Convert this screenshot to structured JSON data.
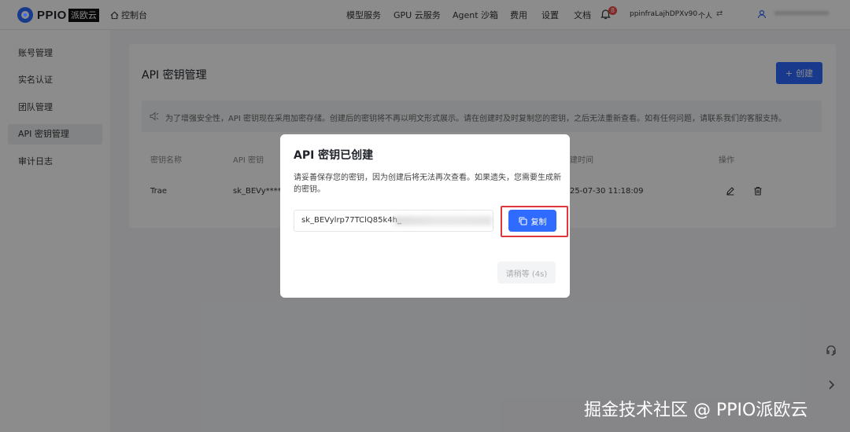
{
  "brand": {
    "name": "PPIO",
    "badge": "派欧云"
  },
  "topbar": {
    "console": "控制台",
    "nav": [
      "模型服务",
      "GPU 云服务",
      "Agent 沙箱",
      "费用",
      "设置",
      "文档"
    ],
    "notifications_count": "8",
    "account_id": "ppinfraLajhDPXv90",
    "account_type": "个人",
    "user_name": "•••••••••••••"
  },
  "sidebar": {
    "items": [
      {
        "label": "账号管理"
      },
      {
        "label": "实名认证"
      },
      {
        "label": "团队管理"
      },
      {
        "label": "API 密钥管理"
      },
      {
        "label": "审计日志"
      }
    ]
  },
  "main": {
    "title": "API 密钥管理",
    "create_label": "创建",
    "notice": "为了增强安全性，API 密钥现在采用加密存储。创建后的密钥将不再以明文形式展示。请在创建时及时复制您的密钥，之后无法重新查看。如有任何问题，请联系我们的客服支持。",
    "table": {
      "headers": [
        "密钥名称",
        "API 密钥",
        "建时间",
        "操作"
      ],
      "rows": [
        {
          "name": "Trae",
          "key": "sk_BEVy****",
          "created": "25-07-30 11:18:09"
        }
      ]
    }
  },
  "modal": {
    "title": "API 密钥已创建",
    "description": "请妥善保存您的密钥，因为创建后将无法再次查看。如果遗失，您需要生成新的密钥。",
    "key_value": "sk_BEVylrp77TClQ85k4h_",
    "copy_label": "复制",
    "wait_label": "请稍等 (4s)"
  },
  "watermark": "掘金技术社区 @ PPIO派欧云",
  "colors": {
    "primary": "#2f6bff",
    "highlight": "#e0353b",
    "badge": "#f04a4a"
  }
}
